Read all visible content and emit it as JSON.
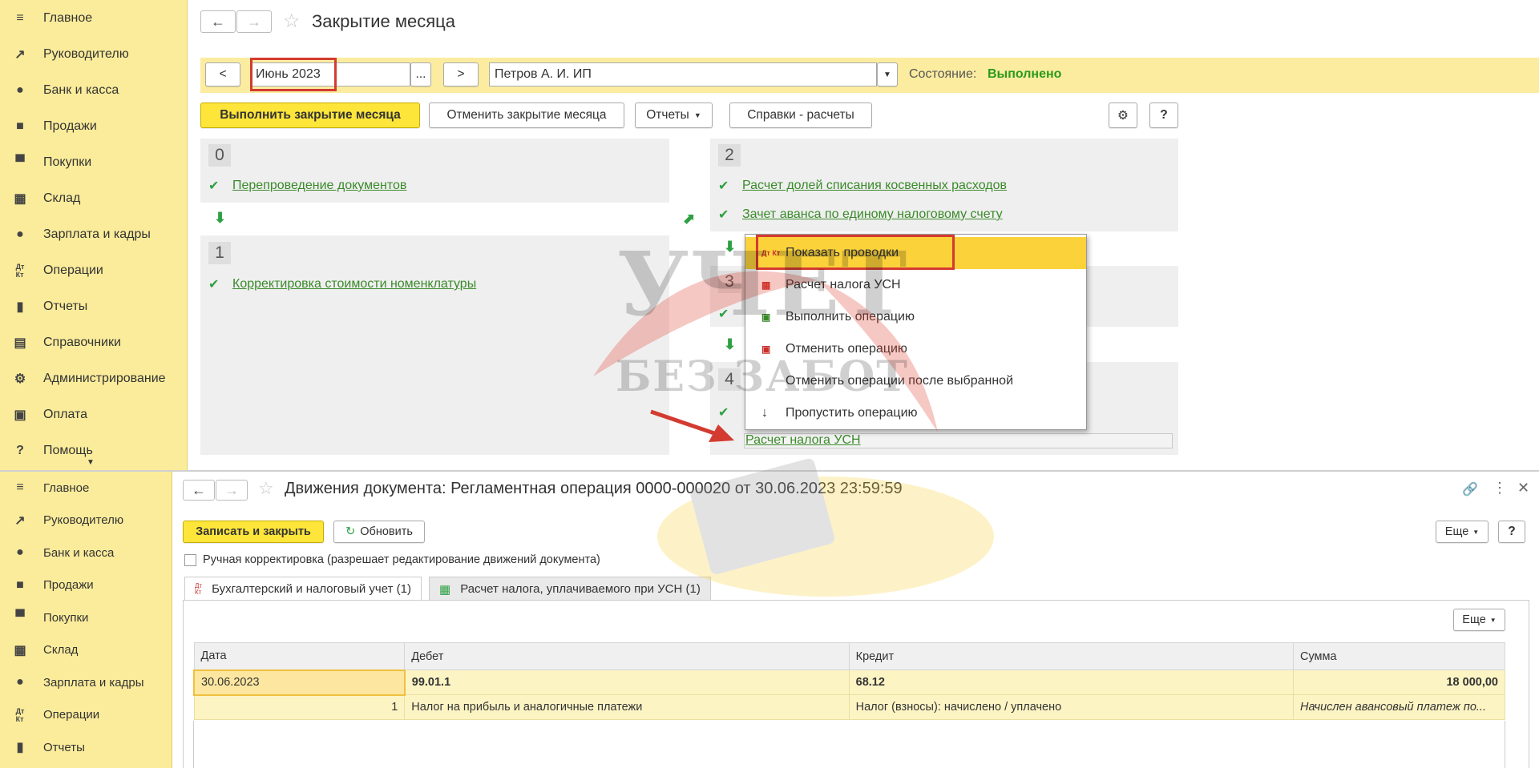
{
  "colors": {
    "sidebar_bg": "#fbec9b",
    "accent": "#fde53a",
    "status_ok": "#2a9a1a",
    "link": "#3a8a2a",
    "highlight_red": "#d33b30"
  },
  "top": {
    "sidebar": {
      "items": [
        {
          "label": "Главное",
          "icon": "menu-icon"
        },
        {
          "label": "Руководителю",
          "icon": "trend-icon"
        },
        {
          "label": "Банк и касса",
          "icon": "coin-icon"
        },
        {
          "label": "Продажи",
          "icon": "bag-icon"
        },
        {
          "label": "Покупки",
          "icon": "cart-icon"
        },
        {
          "label": "Склад",
          "icon": "grid-icon"
        },
        {
          "label": "Зарплата и кадры",
          "icon": "person-icon"
        },
        {
          "label": "Операции",
          "icon": "dt-kt-icon"
        },
        {
          "label": "Отчеты",
          "icon": "bar-chart-icon"
        },
        {
          "label": "Справочники",
          "icon": "books-icon"
        },
        {
          "label": "Администрирование",
          "icon": "gear-icon"
        },
        {
          "label": "Оплата",
          "icon": "wallet-icon"
        },
        {
          "label": "Помощь",
          "icon": "question-icon"
        }
      ]
    },
    "title": "Закрытие месяца",
    "filter": {
      "prev": "<",
      "next": ">",
      "period": "Июнь 2023",
      "ellipsis": "...",
      "org": "Петров А. И. ИП",
      "status_label": "Состояние:",
      "status_value": "Выполнено"
    },
    "toolbar": {
      "run": "Выполнить закрытие месяца",
      "cancel": "Отменить закрытие месяца",
      "reports": "Отчеты",
      "help_calc": "Справки - расчеты",
      "help": "?"
    },
    "sections": {
      "s0": {
        "num": "0",
        "op": "Перепроведение документов"
      },
      "s1": {
        "num": "1",
        "op": "Корректировка стоимости номенклатуры"
      },
      "s2": {
        "num": "2",
        "op1": "Расчет долей списания косвенных расходов",
        "op2": "Зачет аванса по единому налоговому счету"
      },
      "s3": {
        "num": "3"
      },
      "s4": {
        "num": "4",
        "op": "Расчет налога УСН"
      }
    },
    "context_menu": [
      {
        "label": "Показать проводки",
        "icon": "Дт Кт"
      },
      {
        "label": "Расчет налога УСН",
        "icon": "▦"
      },
      {
        "label": "Выполнить операцию",
        "icon": "▣"
      },
      {
        "label": "Отменить операцию",
        "icon": "▣"
      },
      {
        "label": "Отменить операции после выбранной",
        "icon": ""
      },
      {
        "label": "Пропустить операцию",
        "icon": "↓"
      }
    ]
  },
  "bottom": {
    "sidebar": {
      "items": [
        {
          "label": "Главное"
        },
        {
          "label": "Руководителю"
        },
        {
          "label": "Банк и касса"
        },
        {
          "label": "Продажи"
        },
        {
          "label": "Покупки"
        },
        {
          "label": "Склад"
        },
        {
          "label": "Зарплата и кадры"
        },
        {
          "label": "Операции"
        },
        {
          "label": "Отчеты"
        }
      ]
    },
    "title": "Движения документа: Регламентная операция 0000-000020 от 30.06.2023 23:59:59",
    "toolbar": {
      "save_close": "Записать и закрыть",
      "refresh": "Обновить",
      "more": "Еще",
      "help": "?"
    },
    "manual_label": "Ручная корректировка (разрешает редактирование движений документа)",
    "tabs": [
      {
        "label": "Бухгалтерский и налоговый учет (1)"
      },
      {
        "label": "Расчет налога, уплачиваемого при УСН (1)"
      }
    ],
    "table_more": "Еще",
    "table": {
      "headers": [
        "Дата",
        "Дебет",
        "Кредит",
        "Сумма"
      ],
      "row1": {
        "date": "30.06.2023",
        "debit": "99.01.1",
        "credit": "68.12",
        "sum": "18 000,00"
      },
      "row2": {
        "num": "1",
        "debit": "Налог на прибыль и аналогичные платежи",
        "credit": "Налог (взносы): начислено / уплачено",
        "sum": "Начислен авансовый платеж по..."
      }
    }
  },
  "watermark": {
    "line1": "УЧЕТ",
    "line2": "БЕЗ ЗАБОТ"
  }
}
